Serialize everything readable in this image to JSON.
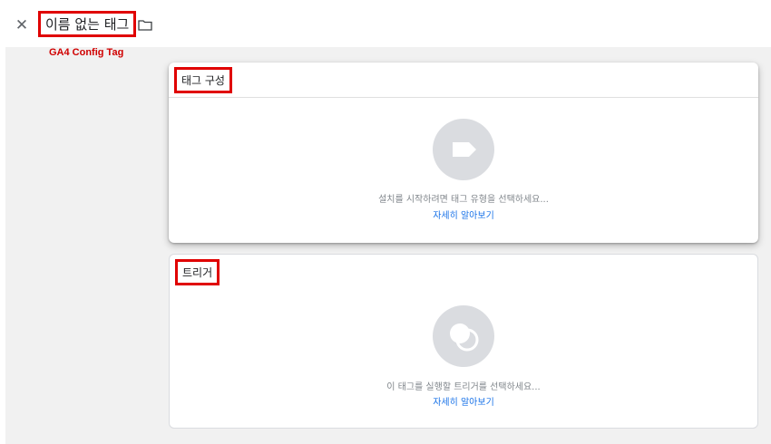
{
  "header": {
    "close_icon": "close-icon",
    "title": "이름 없는 태그",
    "folder_icon": "folder-icon"
  },
  "annotation": "GA4 Config Tag",
  "tag_config": {
    "title": "태그 구성",
    "icon": "tag-icon",
    "hint": "설치를 시작하려면 태그 유형을 선택하세요...",
    "link": "자세히 알아보기"
  },
  "trigger": {
    "title": "트리거",
    "icon": "trigger-icon",
    "hint": "이 태그를 실행할 트리거를 선택하세요...",
    "link": "자세히 알아보기"
  },
  "colors": {
    "highlight": "#e00000",
    "link": "#1a73e8",
    "icon_bg": "#dadce0",
    "background": "#f1f1f1"
  }
}
